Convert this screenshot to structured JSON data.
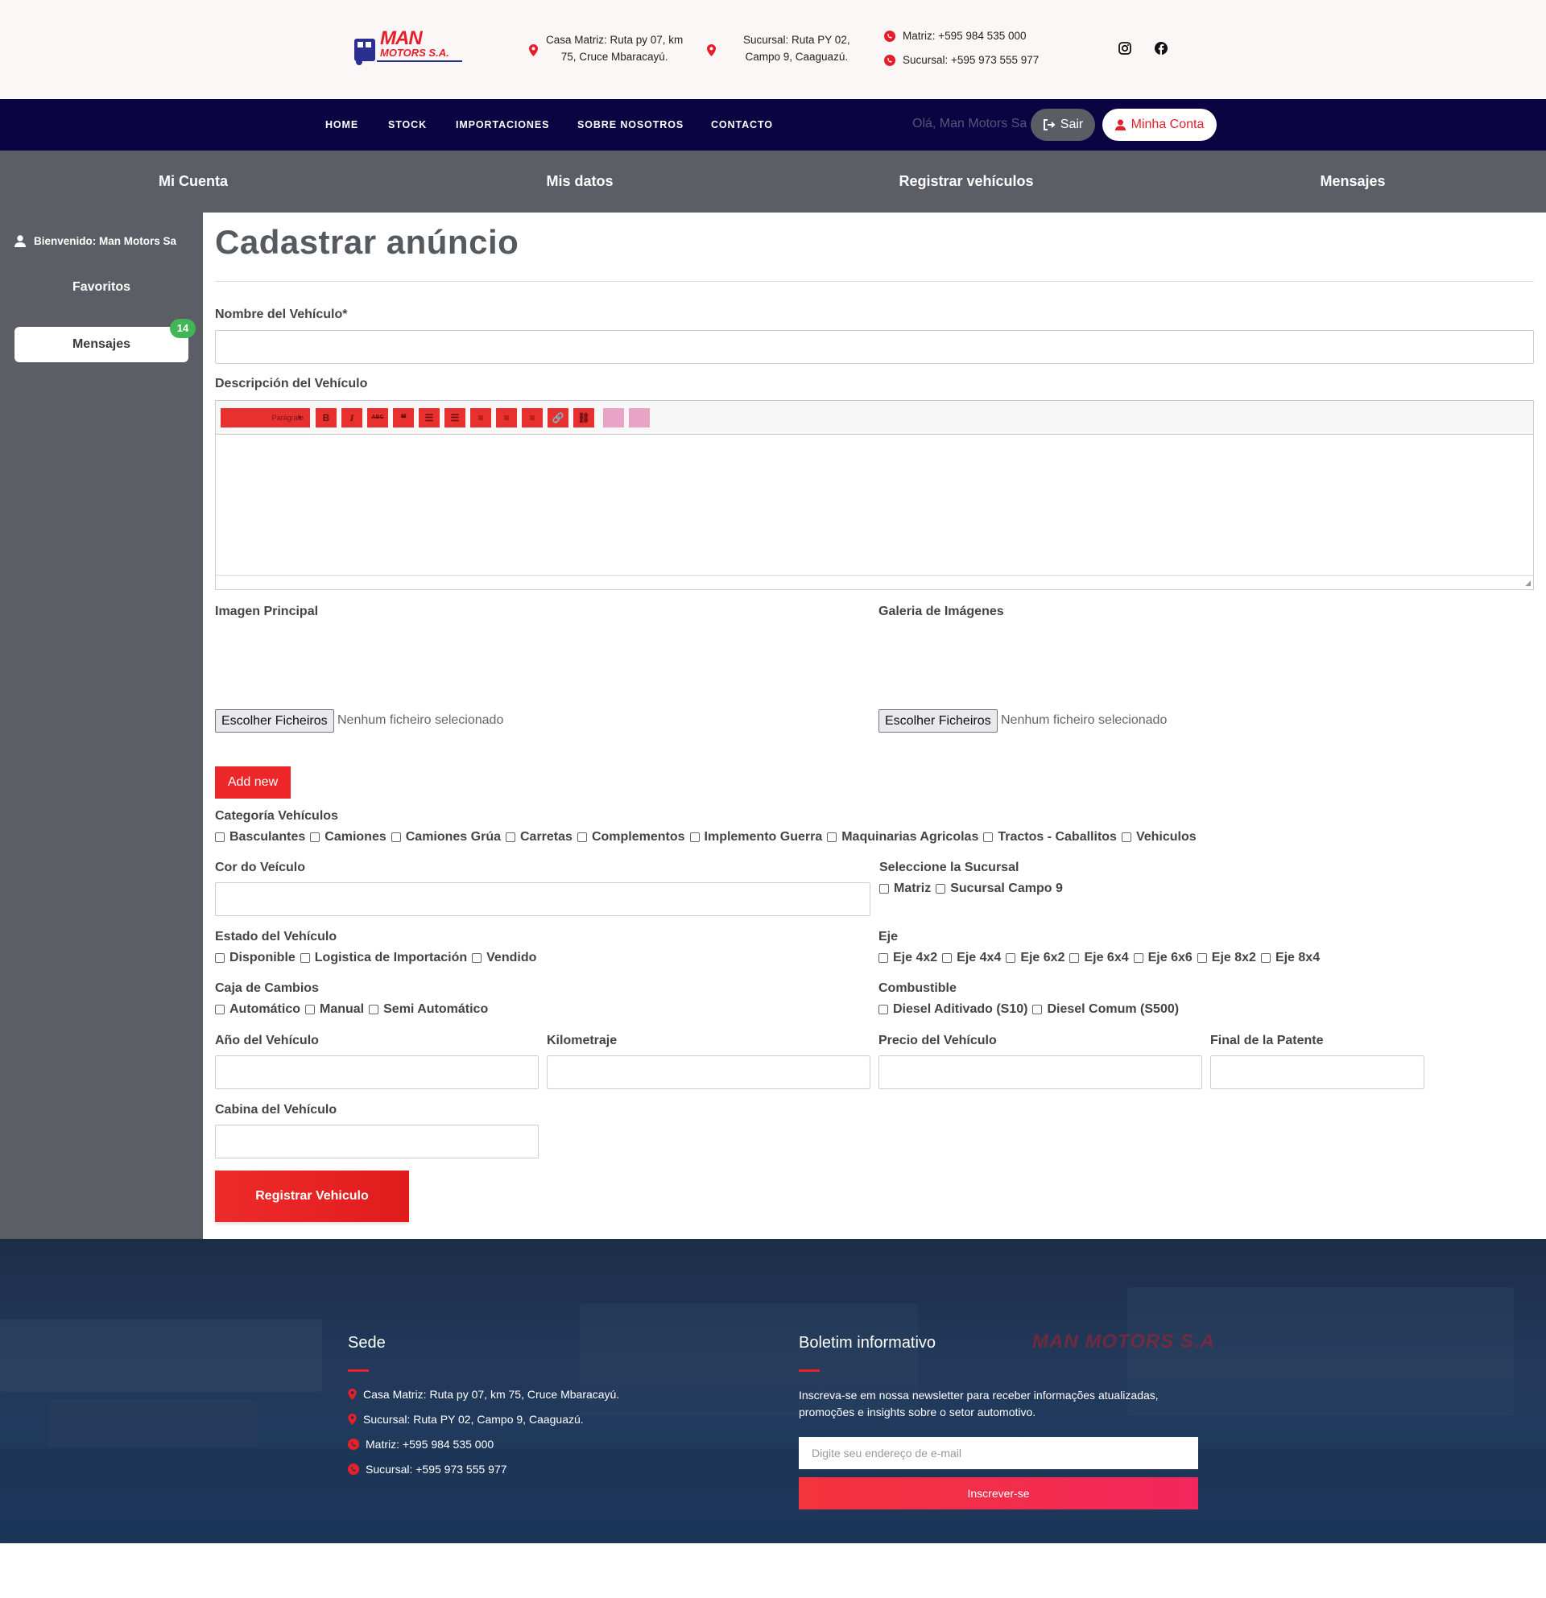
{
  "header": {
    "logo_text": "MAN MOTORS S.A.",
    "locations": [
      {
        "line1": "Casa Matriz: Ruta py 07, km",
        "line2": "75, Cruce Mbaracayú."
      },
      {
        "line1": "Sucursal: Ruta PY 02,",
        "line2": "Campo 9, Caaguazú."
      }
    ],
    "phones": [
      "Matriz: +595 984 535 000",
      "Sucursal: +595 973 555 977"
    ],
    "social_icons": [
      "instagram-icon",
      "facebook-icon"
    ]
  },
  "nav": {
    "items": [
      "HOME",
      "STOCK",
      "IMPORTACIONES",
      "SOBRE NOSOTROS",
      "CONTACTO"
    ],
    "greeting": "Olá, Man Motors Sa",
    "logout_label": "Sair",
    "account_label": "Minha Conta"
  },
  "account_tabs": [
    "Mi Cuenta",
    "Mis datos",
    "Registrar vehículos",
    "Mensajes"
  ],
  "sidebar": {
    "welcome": "Bienvenido: Man Motors Sa",
    "favorites": "Favoritos",
    "messages": "Mensajes",
    "messages_badge": "14"
  },
  "form": {
    "title": "Cadastrar anúncio",
    "name_label": "Nombre del Vehículo*",
    "description_label": "Descripción del Vehículo",
    "editor": {
      "format_select": "Parágrafo",
      "buttons": [
        "B",
        "I",
        "ABC",
        "❝",
        "☰",
        "☰",
        "≡",
        "≡",
        "≡",
        "🔗",
        "⛓"
      ]
    },
    "main_image_label": "Imagen Principal",
    "gallery_label": "Galeria de Imágenes",
    "file_button": "Escolher Ficheiros",
    "file_none": "Nenhum ficheiro selecionado",
    "add_new": "Add new",
    "category_label": "Categoría Vehículos",
    "categories": [
      "Basculantes",
      "Camiones",
      "Camiones Grúa",
      "Carretas",
      "Complementos",
      "Implemento Guerra",
      "Maquinarias Agricolas",
      "Tractos - Caballitos",
      "Vehiculos"
    ],
    "color_label": "Cor do Veículo",
    "branch_label": "Seleccione la Sucursal",
    "branches": [
      "Matriz",
      "Sucursal Campo 9"
    ],
    "state_label": "Estado del Vehículo",
    "states": [
      "Disponible",
      "Logistica de Importación",
      "Vendido"
    ],
    "axle_label": "Eje",
    "axles": [
      "Eje 4x2",
      "Eje 4x4",
      "Eje 6x2",
      "Eje 6x4",
      "Eje 6x6",
      "Eje 8x2",
      "Eje 8x4"
    ],
    "gearbox_label": "Caja de Cambios",
    "gearboxes": [
      "Automático",
      "Manual",
      "Semi Automático"
    ],
    "fuel_label": "Combustible",
    "fuels": [
      "Diesel Aditivado (S10)",
      "Diesel Comum (S500)"
    ],
    "year_label": "Año del Vehículo",
    "km_label": "Kilometraje",
    "price_label": "Precio del Vehículo",
    "plate_label": "Final de la Patente",
    "cabin_label": "Cabina del Vehículo",
    "submit": "Registrar Vehiculo"
  },
  "footer": {
    "sede_title": "Sede",
    "sede_items": [
      "Casa Matriz: Ruta py 07, km 75, Cruce Mbaracayú.",
      "Sucursal: Ruta PY 02, Campo 9, Caaguazú.",
      "Matriz: +595 984 535 000",
      "Sucursal: +595 973 555 977"
    ],
    "newsletter_title": "Boletim informativo",
    "newsletter_desc": "Inscreva-se em nossa newsletter para receber informações atualizadas, promoções e insights sobre o setor automotivo.",
    "email_placeholder": "Digite  seu endereço de e-mail",
    "subscribe_label": "Inscrever-se",
    "watermark": "MAN MOTORS S.A"
  },
  "colors": {
    "brand_red": "#e8202a",
    "navy": "#0a0542",
    "gray": "#5b5e64"
  }
}
